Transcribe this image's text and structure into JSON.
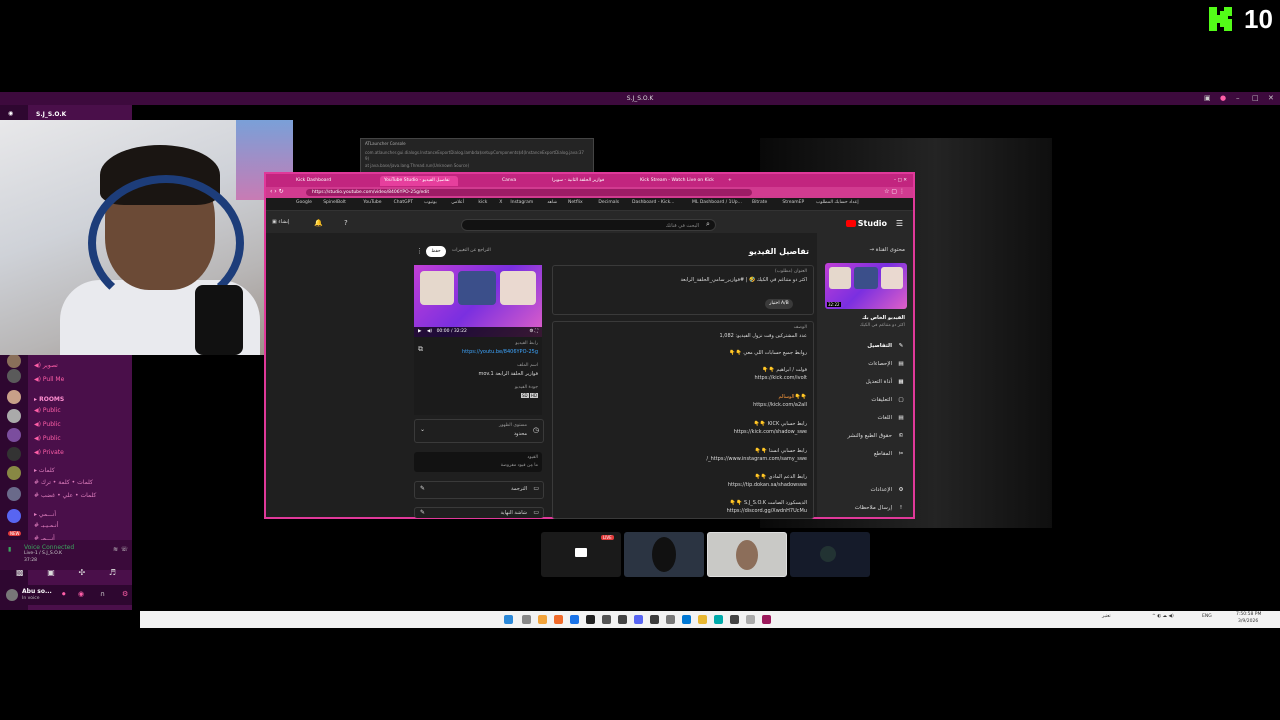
{
  "kick": {
    "count": "10",
    "brand_color": "#53fc18"
  },
  "discord": {
    "window_title": "S.J_S.O.K",
    "server_name": "S.J_S.O.K",
    "channels": [
      {
        "label": "تصوير",
        "icon": "speaker-icon"
      },
      {
        "label": "Pull Me",
        "icon": "speaker-icon"
      },
      {
        "label": "ROOMS",
        "icon": "category-icon"
      },
      {
        "label": "Public",
        "icon": "speaker-icon"
      },
      {
        "label": "Public",
        "icon": "speaker-icon"
      },
      {
        "label": "Public",
        "icon": "speaker-icon"
      },
      {
        "label": "Private",
        "icon": "speaker-icon"
      },
      {
        "label": "كلمات",
        "icon": "category-icon"
      },
      {
        "label": "كلمات • كلمة • ترك",
        "icon": "hash-icon"
      },
      {
        "label": "كلمات • علي • غضب",
        "icon": "hash-icon"
      },
      {
        "label": "أنـــمي",
        "icon": "category-icon"
      },
      {
        "label": "أنـمـيـبـ",
        "icon": "hash-icon"
      },
      {
        "label": "أنـــمـ",
        "icon": "hash-icon"
      }
    ],
    "badges": [
      "275",
      "NEW",
      "278"
    ],
    "voice": {
      "status": "Voice Connected",
      "channel": "Live-1 / S.J_S.O.K",
      "time": "37:28"
    },
    "user": {
      "name": "Abu so...",
      "status": "In voice"
    },
    "accent": "#4a0f4a"
  },
  "console": {
    "title": "ATLauncher Console",
    "lines": [
      "com.atlauncher.gui.dialogs.InstanceExportDialog.lambda$setupComponents$4(InstanceExportDialog.java:37",
      "9)",
      "at java.base/java.lang.Thread.run(Unknown Source)"
    ]
  },
  "browser": {
    "tabs": [
      "Kick Dashboard",
      "YouTube Studio - تفاصيل الفيديو",
      "Canva",
      "فوازير الحلقة الثانية - سوبرا",
      "Kick Stream - Watch Live on Kick"
    ],
    "url": "https://studio.youtube.com/video/8406YPO-25g/edit",
    "bookmarks": [
      "Google",
      "SpinelBolt",
      "YouTube",
      "ChatGPT",
      "يوتيوب",
      "أعلامي",
      "kick",
      "X",
      "Instagram",
      "شاهد",
      "Netflix",
      "Decimals",
      "Dashboard - Kick...",
      "ML Dashboard / 1Up...",
      "Bitrate",
      "StreamEP",
      "إعداد حسابك المطلوب"
    ],
    "accent": "#e0399a"
  },
  "studio": {
    "logo": "Studio",
    "search_placeholder": "البحث في قناتك",
    "header_actions": {
      "go_live": "إنشاء",
      "undo_changes": "التراجع عن التغييرات",
      "save": "حفظ"
    },
    "page_title": "تفاصيل الفيديو",
    "back_label": "محتوى القناة",
    "nav": [
      {
        "label": "التفاصيل",
        "icon": "pencil-icon",
        "selected": true
      },
      {
        "label": "الإحصاءات",
        "icon": "analytics-icon",
        "selected": false
      },
      {
        "label": "أداة التعديل",
        "icon": "editor-icon",
        "selected": false
      },
      {
        "label": "التعليقات",
        "icon": "comments-icon",
        "selected": false
      },
      {
        "label": "اللغات",
        "icon": "languages-icon",
        "selected": false
      },
      {
        "label": "حقوق الطبع والنشر",
        "icon": "copyright-icon",
        "selected": false
      },
      {
        "label": "المقاطع",
        "icon": "scissors-icon",
        "selected": false
      },
      {
        "label": "الإعدادات",
        "icon": "gear-icon",
        "selected": false
      },
      {
        "label": "إرسال ملاحظات",
        "icon": "feedback-icon",
        "selected": false
      }
    ],
    "sidebar_video": {
      "label": "الفيديو الخاص بك",
      "title": "اكثر دو متناغم في الكيك",
      "duration": "32:22"
    },
    "title_field": {
      "label": "العنوان (مطلوب)",
      "value": "اكثر دو متناغم في الكيك 🤣 | #فوازير_سامي_الحلقة_الرابعة",
      "ab_button": "اختبار A/B"
    },
    "description": {
      "label": "الوصف",
      "lines": [
        "عدد المشتركين وقت نزول الفيديو: 1,082",
        "روابط جميع حسابات اللي معي 👇👇",
        "فولت / ابراهيم 👇👇",
        "https://kick.com/ivolt",
        "👇👇الوسالم",
        "https://kick.com/a2all",
        "رابط حسابي KICK 👇👇",
        "https://kick.com/shadow_swe",
        "رابط حسابي انستا 👇👇",
        "https://www.instagram.com/samy_swe_/",
        "رابط الدعم المادي 👇👇",
        "https://tip.dokan.sa/shadowswe",
        "الديسكورد الصامت S.J_S.O.K 👇👇",
        "https://discord.gg/XwdnH7UcMu"
      ]
    },
    "video_card": {
      "time": "00:00 / 32:22",
      "link_label": "رابط الفيديو",
      "link": "https://youtu.be/8406YPO-25g",
      "file_label": "اسم الملف",
      "file_name": "فوازير الحلقة الرابعة mov.1",
      "quality_label": "جودة الفيديو",
      "quality_values": [
        "SD",
        "HD"
      ]
    },
    "visibility": {
      "label": "مستوى الظهور",
      "value": "محدود"
    },
    "restrictions": {
      "label": "القيود",
      "value": "ما مِن قيود مفروضة"
    },
    "subtitles": {
      "label": "الترجمة"
    },
    "end_screen": {
      "label": "شاشة النهاية"
    }
  },
  "participants": {
    "live_badge": "LIVE"
  },
  "taskbar": {
    "weather": "تعتبر",
    "lang": "ENG",
    "time": "7:50:58 PM",
    "date": "3/9/2026"
  }
}
